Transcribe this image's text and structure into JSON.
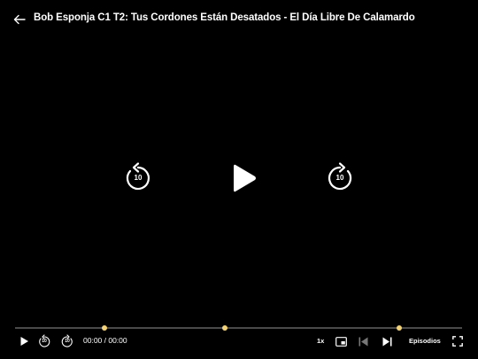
{
  "header": {
    "title": "Bob Esponja C1 T2: Tus Cordones Están Desatados - El Día Libre De Calamardo"
  },
  "center_controls": {
    "rewind_label": "10",
    "forward_label": "10"
  },
  "progress": {
    "played_fraction": 0,
    "marker_fractions": [
      0.2,
      0.47,
      0.86
    ],
    "marker_color": "#f3d37a"
  },
  "bottom_controls": {
    "rewind_label": "10",
    "forward_label": "10",
    "time": "00:00 / 00:00",
    "speed": "1x",
    "episodes_label": "Episodios"
  },
  "icons": [
    "back-arrow-icon",
    "rewind-10-icon",
    "play-icon",
    "forward-10-icon",
    "picture-in-picture-icon",
    "previous-episode-icon",
    "next-episode-icon",
    "fullscreen-icon"
  ]
}
